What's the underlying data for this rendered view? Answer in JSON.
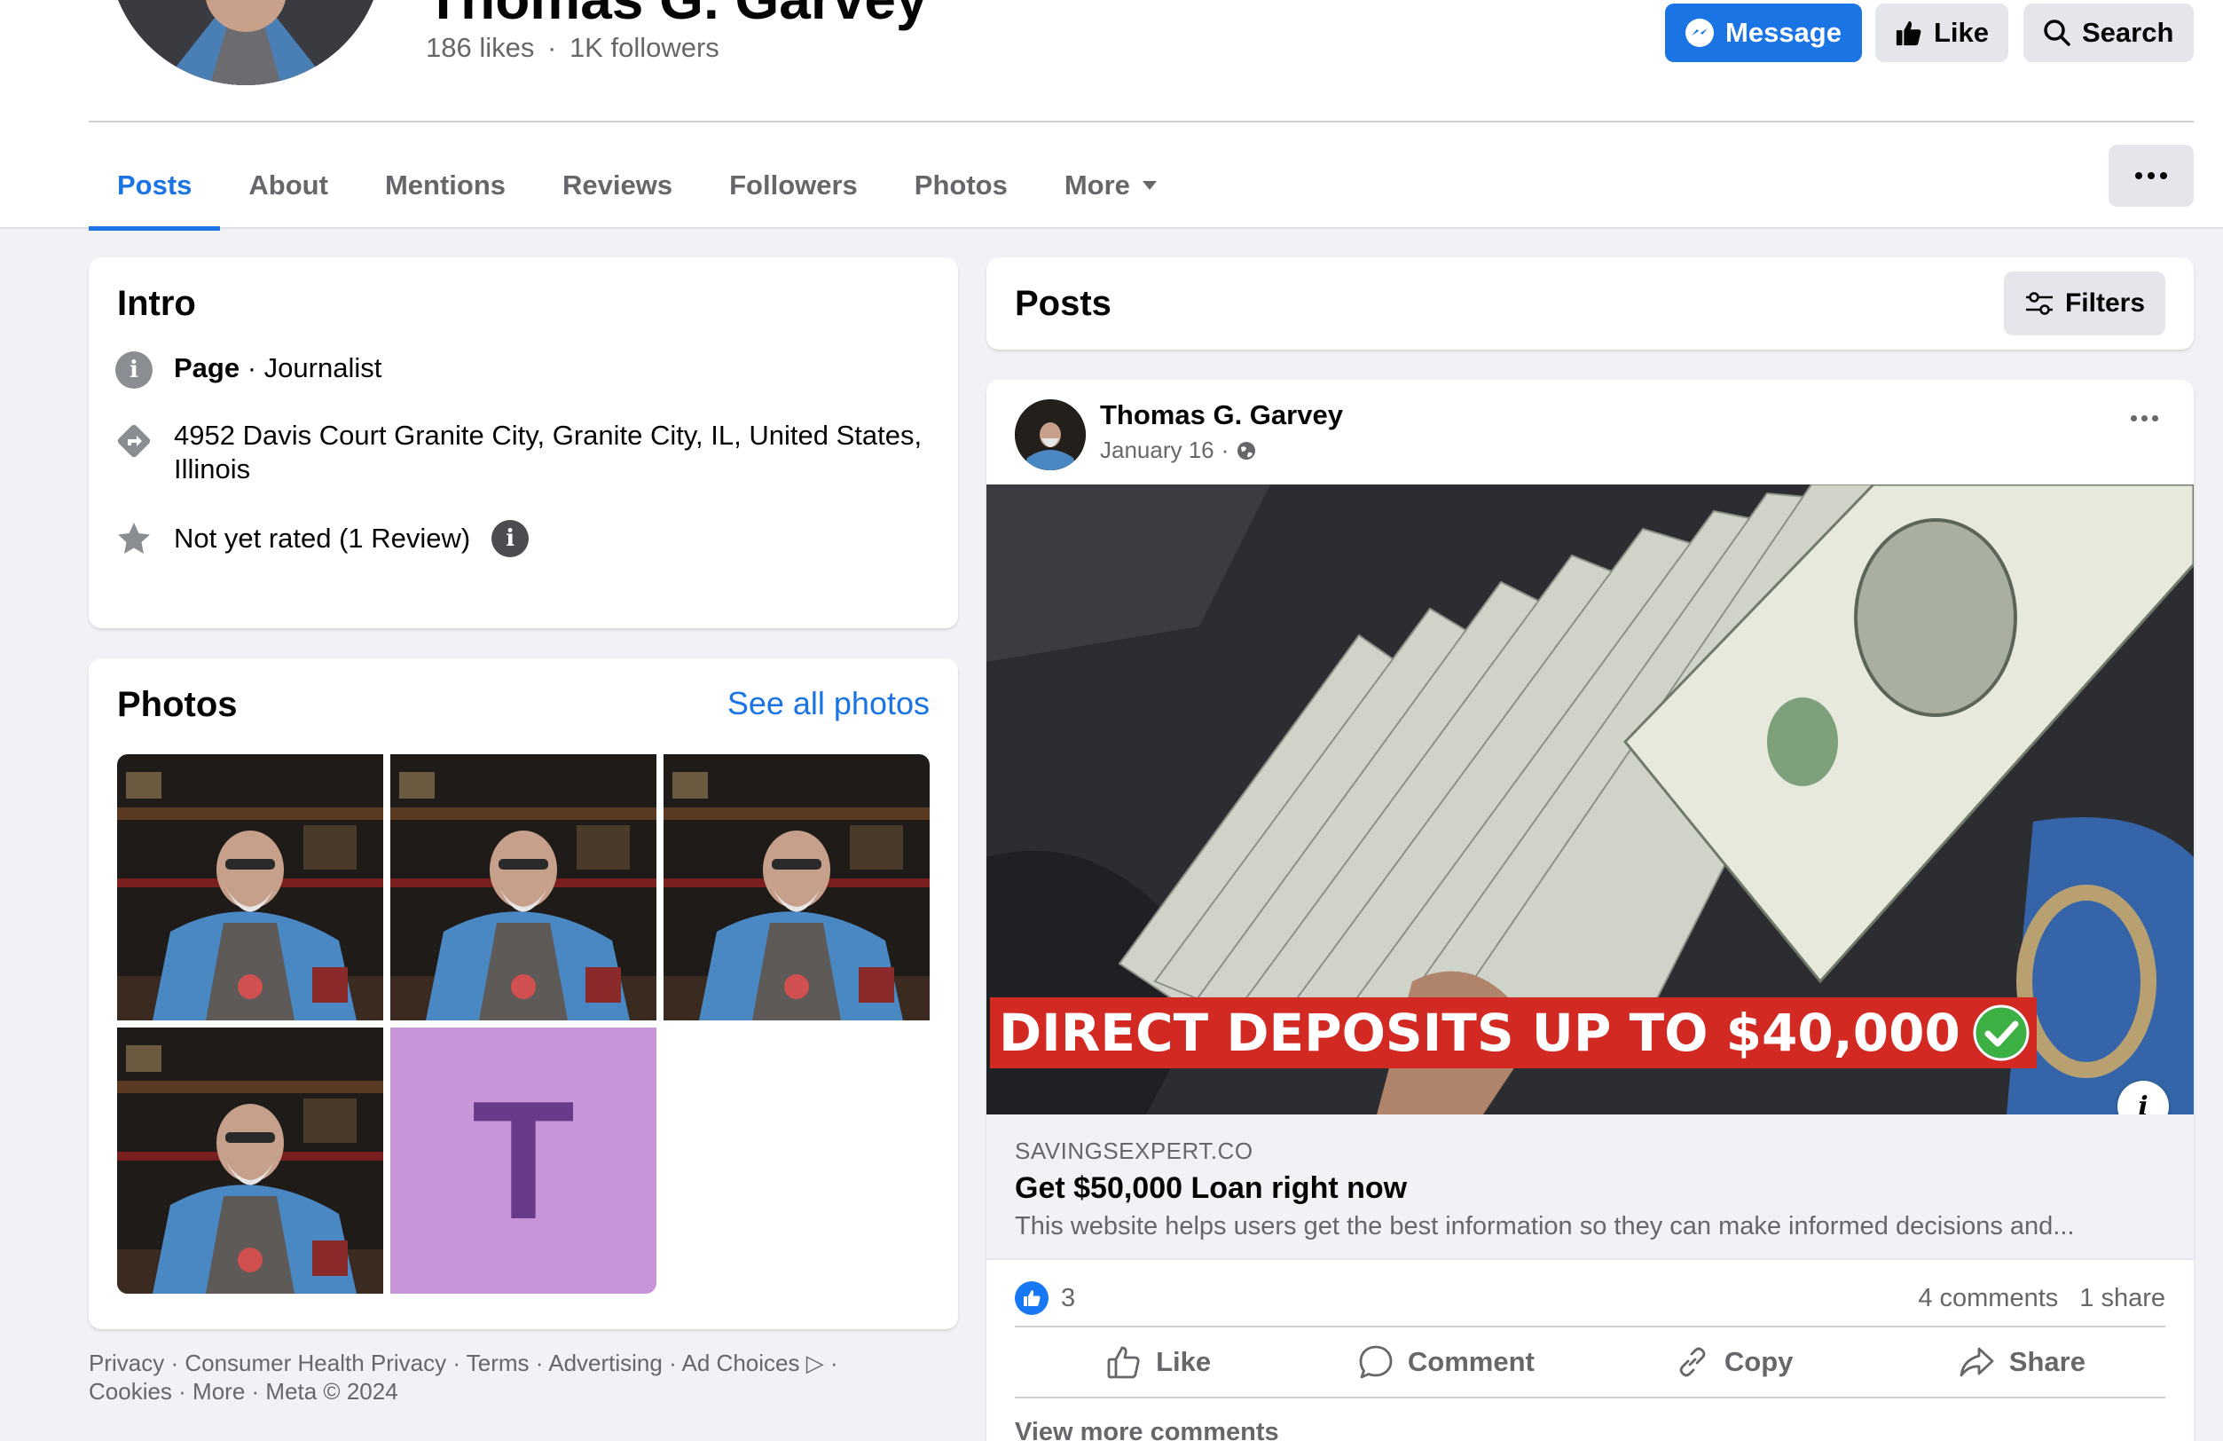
{
  "profile": {
    "name": "Thomas G. Garvey",
    "likes": "186 likes",
    "separator": "·",
    "followers": "1K followers"
  },
  "header_actions": {
    "message": "Message",
    "like": "Like",
    "search": "Search"
  },
  "tabs": [
    {
      "label": "Posts",
      "active": true
    },
    {
      "label": "About"
    },
    {
      "label": "Mentions"
    },
    {
      "label": "Reviews"
    },
    {
      "label": "Followers"
    },
    {
      "label": "Photos"
    },
    {
      "label": "More"
    }
  ],
  "intro": {
    "title": "Intro",
    "category_label": "Page",
    "category_value": " · Journalist",
    "address": "4952 Davis Court Granite City, Granite City, IL, United States, Illinois",
    "rating": "Not yet rated (1 Review)"
  },
  "photos": {
    "title": "Photos",
    "see_all": "See all photos",
    "letter_tile": "T"
  },
  "footer": {
    "links": [
      "Privacy",
      "Consumer Health Privacy",
      "Terms",
      "Advertising",
      "Ad Choices"
    ],
    "links_line2": [
      "Cookies",
      "More"
    ],
    "copyright": "Meta © 2024"
  },
  "posts_section": {
    "title": "Posts",
    "filters": "Filters"
  },
  "post": {
    "author": "Thomas G. Garvey",
    "date": "January 16",
    "date_sep": "·",
    "banner": "DIRECT DEPOSITS UP TO $40,000",
    "link_domain": "SAVINGSEXPERT.CO",
    "link_title": "Get $50,000 Loan right now",
    "link_description": "This website helps users get the best information so they can make informed decisions and...",
    "reaction_count": "3",
    "comments": "4 comments",
    "shares": "1 share",
    "actions": [
      "Like",
      "Comment",
      "Copy",
      "Share"
    ],
    "view_more": "View more comments"
  },
  "colors": {
    "accent": "#1b74e4",
    "banner_red": "#d22a22",
    "check_green": "#3cb043",
    "tile_purple": "#c896d8"
  }
}
